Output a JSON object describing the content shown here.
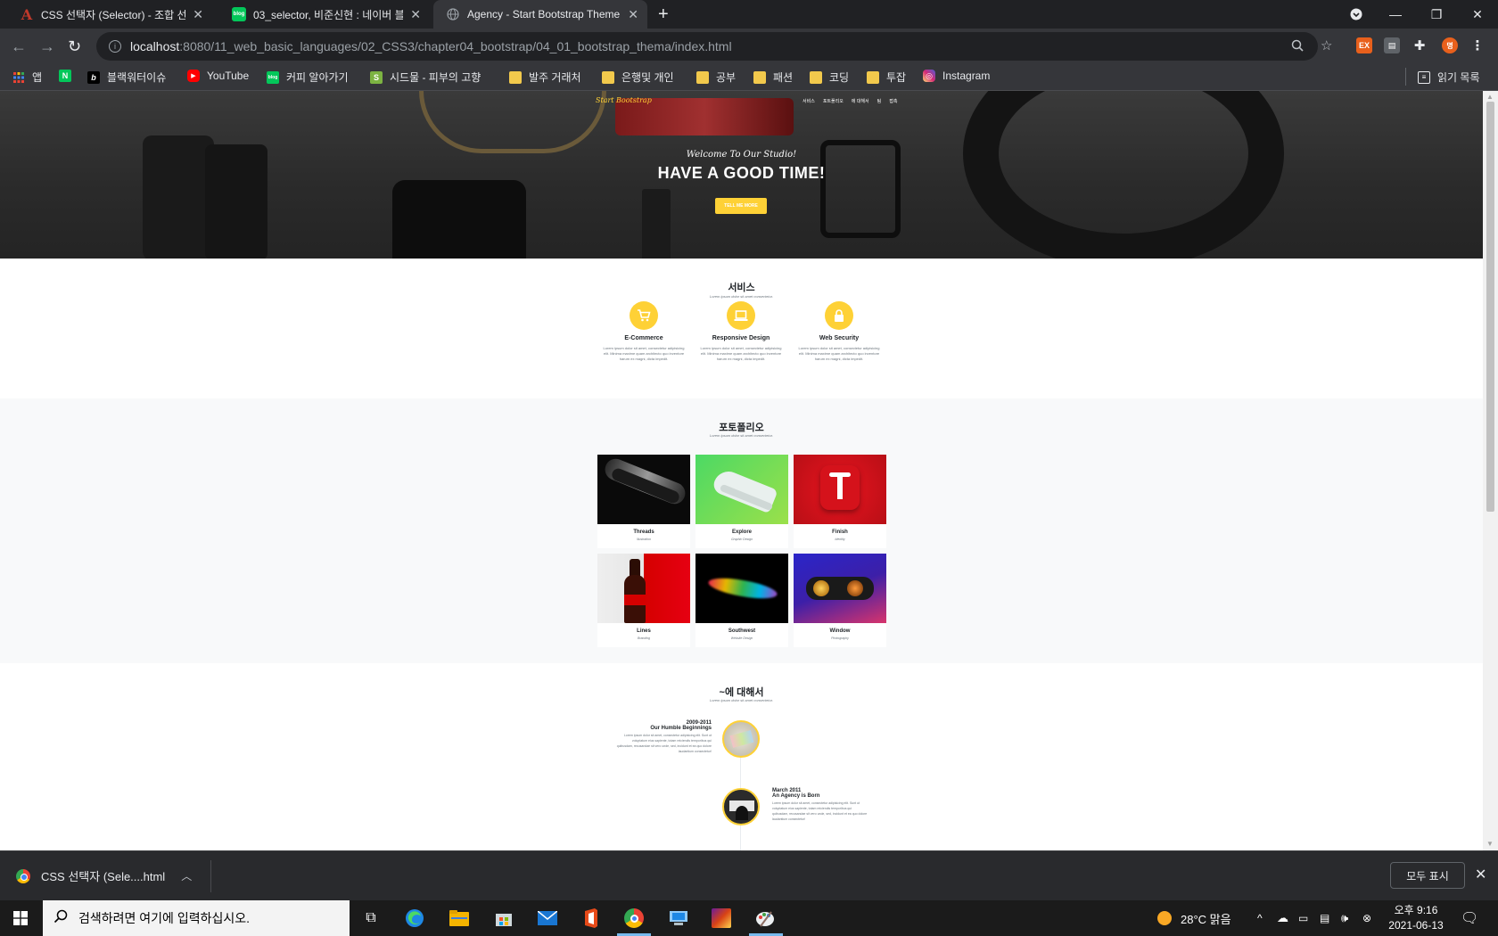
{
  "browser": {
    "tabs": [
      {
        "title": "CSS 선택자 (Selector) - 조합 선택",
        "favicon": "A",
        "favicon_color": "#c0392b",
        "active": false
      },
      {
        "title": "03_selector, 비준신현 : 네이버 블",
        "favicon": "blog",
        "favicon_color": "#03c75a",
        "active": false
      },
      {
        "title": "Agency - Start Bootstrap Theme",
        "favicon": "globe",
        "favicon_color": "#9aa0a6",
        "active": true
      }
    ],
    "new_tab": "+",
    "url_host": "localhost",
    "url_path": ":8080/11_web_basic_languages/02_CSS3/chapter04_bootstrap/04_01_bootstrap_thema/index.html",
    "profile_initial": "명",
    "bookmarks": [
      {
        "label": "앱",
        "icon": "apps-grid-icon"
      },
      {
        "label": "",
        "icon": "naver-icon"
      },
      {
        "label": "블랙워터이슈",
        "icon": "b-icon"
      },
      {
        "label": "YouTube",
        "icon": "youtube-icon"
      },
      {
        "label": "커피 알아가기",
        "icon": "blog-icon"
      },
      {
        "label": "시드물 - 피부의 고향",
        "icon": "s-icon"
      },
      {
        "label": "발주 거래처",
        "icon": "folder-icon"
      },
      {
        "label": "은행및 개인",
        "icon": "folder-icon"
      },
      {
        "label": "공부",
        "icon": "folder-icon"
      },
      {
        "label": "패션",
        "icon": "folder-icon"
      },
      {
        "label": "코딩",
        "icon": "folder-icon"
      },
      {
        "label": "투잡",
        "icon": "folder-icon"
      },
      {
        "label": "Instagram",
        "icon": "instagram-icon"
      }
    ],
    "reading_list": "읽기 목록"
  },
  "page": {
    "brand": "Start Bootstrap",
    "nav": [
      "서비스",
      "포트폴리오",
      "에 대해서",
      "팀",
      "접촉"
    ],
    "hero": {
      "subheading": "Welcome To Our Studio!",
      "heading": "HAVE A GOOD TIME!",
      "button": "TELL ME MORE"
    },
    "services": {
      "title": "서비스",
      "subtitle": "Lorem ipsum dolor sit amet consectetur.",
      "items": [
        {
          "name": "E-Commerce",
          "icon": "cart-icon",
          "desc": "Lorem ipsum dolor sit amet, consectetur adipisicing elit. Minima maxime quam architecto quo inventore harum ex magni, dicta impedit."
        },
        {
          "name": "Responsive Design",
          "icon": "laptop-icon",
          "desc": "Lorem ipsum dolor sit amet, consectetur adipisicing elit. Minima maxime quam architecto quo inventore harum ex magni, dicta impedit."
        },
        {
          "name": "Web Security",
          "icon": "lock-icon",
          "desc": "Lorem ipsum dolor sit amet, consectetur adipisicing elit. Minima maxime quam architecto quo inventore harum ex magni, dicta impedit."
        }
      ]
    },
    "portfolio": {
      "title": "포토폴리오",
      "subtitle": "Lorem ipsum dolor sit amet consectetur.",
      "items": [
        {
          "name": "Threads",
          "category": "Illustration"
        },
        {
          "name": "Explore",
          "category": "Graphic Design"
        },
        {
          "name": "Finish",
          "category": "Identity"
        },
        {
          "name": "Lines",
          "category": "Branding"
        },
        {
          "name": "Southwest",
          "category": "Website Design"
        },
        {
          "name": "Window",
          "category": "Photography"
        }
      ]
    },
    "about": {
      "title": "~에 대해서",
      "subtitle": "Lorem ipsum dolor sit amet consectetur.",
      "timeline": [
        {
          "date": "2009-2011",
          "heading": "Our Humble Beginnings",
          "body": "Lorem ipsum dolor sit amet, consectetur adipisicing elit. Sunt ut voluptatum eius sapiente, totam reiciendis temporibus qui quibusdam, recusandae sit vero unde, sed, incidunt et ea quo dolore laudantium consectetur!"
        },
        {
          "date": "March 2011",
          "heading": "An Agency is Born",
          "body": "Lorem ipsum dolor sit amet, consectetur adipisicing elit. Sunt ut voluptatum eius sapiente, totam reiciendis temporibus qui quibusdam, recusandae sit vero unde, sed, incidunt et ea quo dolore laudantium consectetur!"
        }
      ]
    }
  },
  "download_bar": {
    "file": "CSS 선택자 (Sele....html",
    "show_all": "모두 표시"
  },
  "taskbar": {
    "search_placeholder": "검색하려면 여기에 입력하십시오.",
    "weather": "28°C  맑음",
    "time": "오후 9:16",
    "date": "2021-06-13"
  },
  "colors": {
    "accent": "#fed136",
    "chrome_dark": "#202124",
    "chrome_toolbar": "#35363a"
  }
}
